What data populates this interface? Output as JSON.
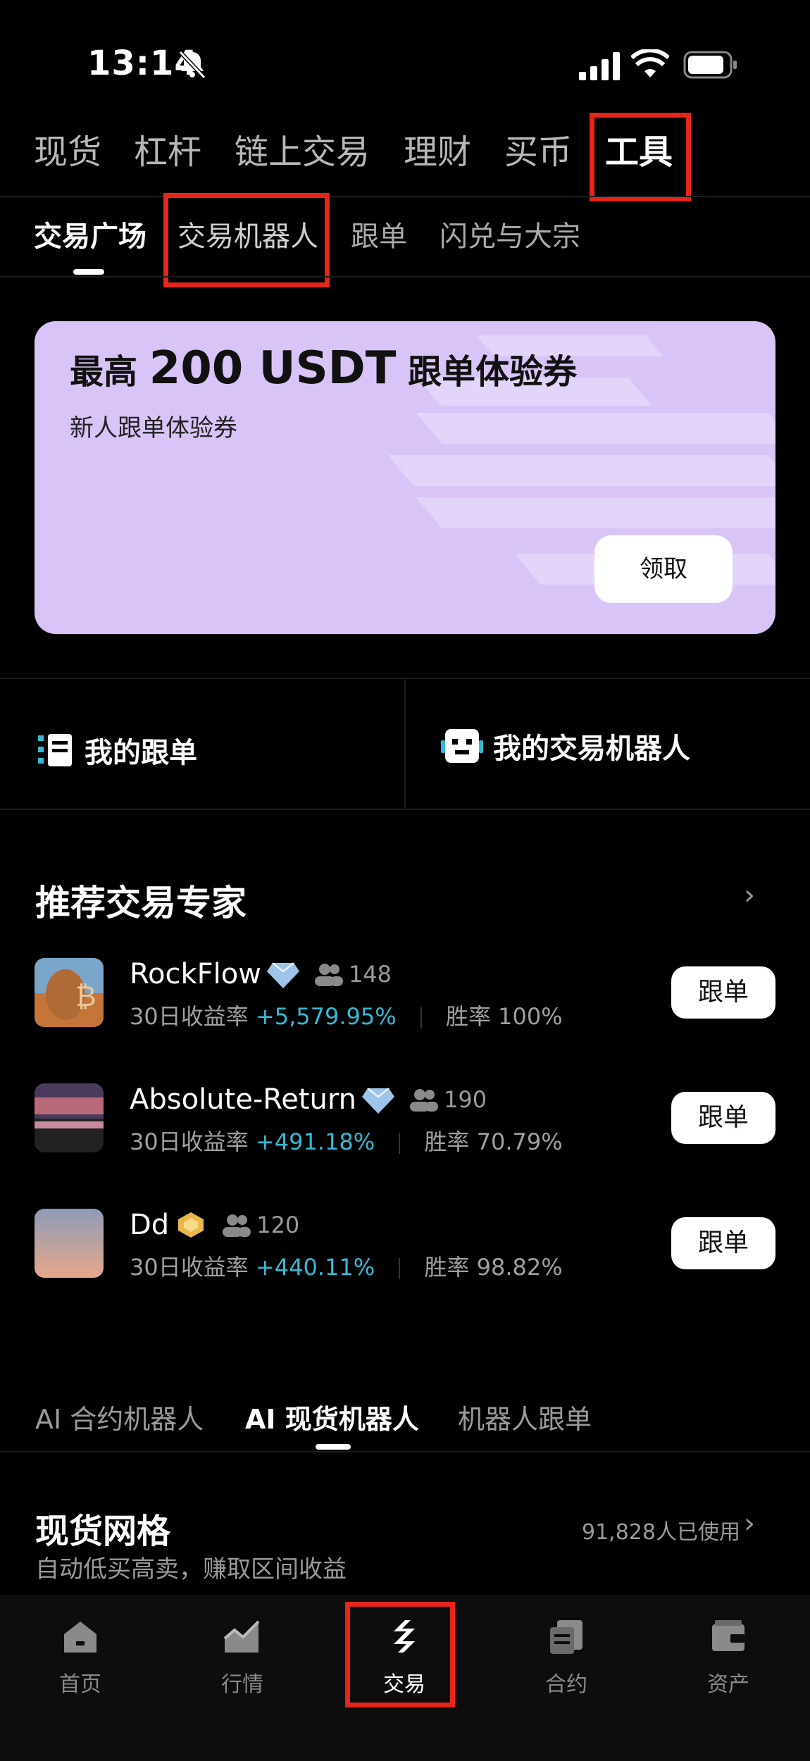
{
  "status_bar": {
    "time": "13:14"
  },
  "top_tabs": [
    "现货",
    "杠杆",
    "链上交易",
    "理财",
    "买币",
    "工具"
  ],
  "sub_tabs": [
    "交易广场",
    "交易机器人",
    "跟单",
    "闪兑与大宗"
  ],
  "banner": {
    "title_prefix": "最高",
    "title_amount": "200 USDT",
    "title_suffix": "跟单体验券",
    "subtitle": "新人跟单体验券",
    "claim_label": "领取"
  },
  "quick_links": {
    "my_copy": "我的跟单",
    "my_bots": "我的交易机器人"
  },
  "experts": {
    "title": "推荐交易专家",
    "follow_label": "跟单",
    "return_label": "30日收益率",
    "winrate_label": "胜率",
    "items": [
      {
        "name": "RockFlow",
        "followers": "148",
        "return": "+5,579.95%",
        "winrate": "100%",
        "badge": "diamond"
      },
      {
        "name": "Absolute-Return",
        "followers": "190",
        "return": "+491.18%",
        "winrate": "70.79%",
        "badge": "diamond"
      },
      {
        "name": "Dd",
        "followers": "120",
        "return": "+440.11%",
        "winrate": "98.82%",
        "badge": "gold"
      }
    ]
  },
  "bot_tabs": [
    "AI 合约机器人",
    "AI 现货机器人",
    "机器人跟单"
  ],
  "grid": {
    "title": "现货网格",
    "subtitle": "自动低买高卖，赚取区间收益",
    "users": "91,828人已使用"
  },
  "nav": [
    {
      "label": "首页",
      "icon": "home-icon"
    },
    {
      "label": "行情",
      "icon": "market-icon"
    },
    {
      "label": "交易",
      "icon": "trade-icon"
    },
    {
      "label": "合约",
      "icon": "contract-icon"
    },
    {
      "label": "资产",
      "icon": "wallet-icon"
    }
  ],
  "colors": {
    "accent_red": "#e5261a",
    "return_blue": "#36b9d6",
    "banner_bg": "#d9c4f7"
  }
}
